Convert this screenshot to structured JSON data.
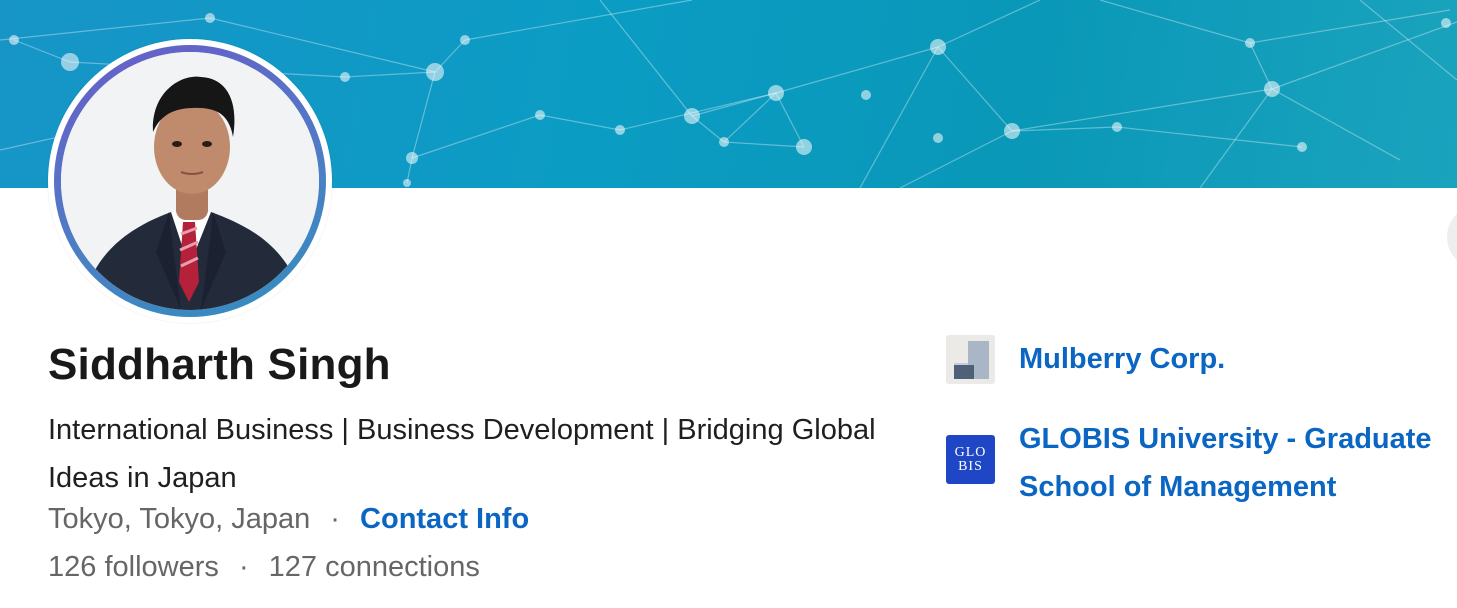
{
  "profile": {
    "name": "Siddharth Singh",
    "headline": "International Business | Business Development | Bridging Global Ideas in Japan",
    "location": "Tokyo, Tokyo, Japan",
    "separator": "·",
    "contact_info_label": "Contact Info",
    "followers": "126 followers",
    "connections": "127 connections"
  },
  "organizations": [
    {
      "name": "Mulberry Corp.",
      "logo_icon": "mulberry-logo"
    },
    {
      "name": "GLOBIS University - Graduate School of Management",
      "logo_icon": "globis-logo",
      "logo_text_line1": "GLO",
      "logo_text_line2": "BIS"
    }
  ],
  "colors": {
    "link": "#0a66c2",
    "banner": "#0b9cc4",
    "text_primary": "#191919",
    "text_secondary": "#666666"
  }
}
